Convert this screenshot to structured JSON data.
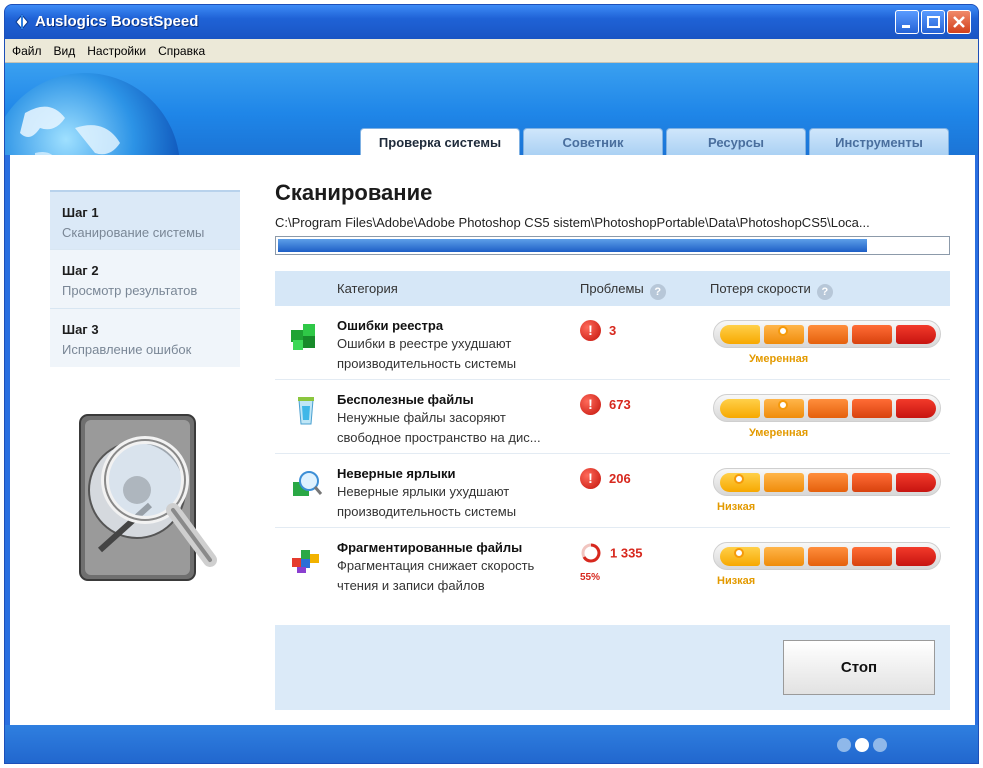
{
  "window": {
    "title": "Auslogics BoostSpeed"
  },
  "menu": [
    "Файл",
    "Вид",
    "Настройки",
    "Справка"
  ],
  "tabs": [
    "Проверка системы",
    "Советник",
    "Ресурсы",
    "Инструменты"
  ],
  "steps": [
    {
      "title": "Шаг 1",
      "subtitle": "Сканирование системы"
    },
    {
      "title": "Шаг 2",
      "subtitle": "Просмотр результатов"
    },
    {
      "title": "Шаг 3",
      "subtitle": "Исправление ошибок"
    }
  ],
  "scan": {
    "title": "Сканирование",
    "path": "C:\\Program Files\\Adobe\\Adobe Photoshop CS5 sistem\\PhotoshopPortable\\Data\\PhotoshopCS5\\Loca...",
    "progress_fraction": 0.88
  },
  "table": {
    "headers": {
      "category": "Категория",
      "problems": "Проблемы",
      "speed_loss": "Потеря скорости"
    },
    "rows": [
      {
        "name": "Ошибки реестра",
        "desc1": "Ошибки в реестре ухудшают",
        "desc2": "производительность системы",
        "count": "3",
        "level_label": "Умеренная",
        "level": 2
      },
      {
        "name": "Бесполезные файлы",
        "desc1": "Ненужные файлы засоряют",
        "desc2": "свободное пространство на дис...",
        "count": "673",
        "level_label": "Умеренная",
        "level": 2
      },
      {
        "name": "Неверные ярлыки",
        "desc1": "Неверные ярлыки ухудшают",
        "desc2": "производительность системы",
        "count": "206",
        "level_label": "Низкая",
        "level": 1
      },
      {
        "name": "Фрагментированные файлы",
        "desc1": "Фрагментация снижает скорость",
        "desc2": "чтения и записи файлов",
        "count": "1 335",
        "percent": "55%",
        "level_label": "Низкая",
        "level": 1
      }
    ]
  },
  "buttons": {
    "stop": "Стоп"
  },
  "pager": {
    "pages": 3,
    "active": 2
  },
  "colors": {
    "accent": "#1f62d6",
    "problem": "#d7281e",
    "level": "#e39a00"
  },
  "icons": [
    "app-icon",
    "globe-icon",
    "help-icon",
    "registry-icon",
    "junk-files-icon",
    "shortcut-icon",
    "fragmented-files-icon",
    "alert-icon",
    "spinner-icon",
    "hard-drive-icon"
  ]
}
